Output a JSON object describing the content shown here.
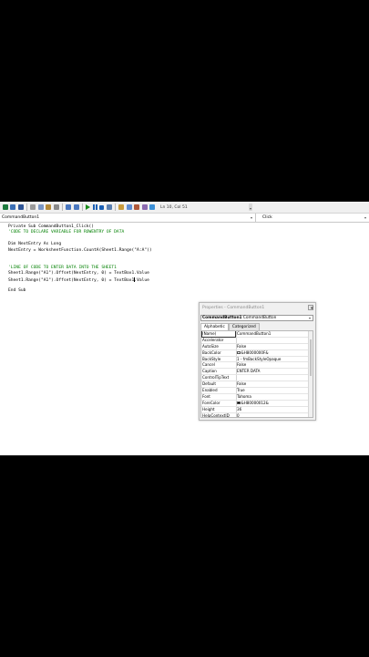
{
  "toolbar": {
    "icons": [
      "excel-icon",
      "insert-userform-icon",
      "save-icon",
      "cut-icon",
      "copy-icon",
      "paste-icon",
      "find-icon",
      "undo-icon",
      "redo-icon",
      "run-icon",
      "break-icon",
      "reset-icon",
      "design-mode-icon",
      "project-explorer-icon",
      "properties-icon",
      "object-browser-icon",
      "toolbox-icon",
      "help-icon"
    ],
    "status": "Ln 10, Col 51"
  },
  "object_combo": "CommandButton1",
  "procedure_combo": "Click",
  "code": {
    "lines": [
      {
        "text": "Private Sub CommandButton1_Click()",
        "type": "code"
      },
      {
        "text": "'CODE TO DECLARE VARIABLE FOR ROWENTRY OF DATA",
        "type": "comment"
      },
      {
        "text": "",
        "type": "code"
      },
      {
        "text": "Dim NextEntry As Long",
        "type": "code"
      },
      {
        "text": "NextEntry = WorksheetFunction.CountA(Sheet1.Range(\"A:A\"))",
        "type": "code"
      },
      {
        "text": "",
        "type": "code"
      },
      {
        "text": "",
        "type": "code"
      },
      {
        "text": "'LINE OF CODE TO ENTER DATA INTO THE SHEET1",
        "type": "comment"
      },
      {
        "text": "Sheet1.Range(\"A1\").Offset(NextEntry, 0) = TextBox1.Value",
        "type": "code"
      },
      {
        "text": "Sheet1.Range(\"A1\").Offset(NextEntry, 0) = TextBox1.Value",
        "type": "code"
      },
      {
        "text": "",
        "type": "code"
      },
      {
        "text": "End Sub",
        "type": "code"
      }
    ]
  },
  "properties": {
    "title": "Properties - CommandButton1",
    "object_name": "CommandButton1",
    "object_type": "CommandButton",
    "tabs": [
      "Alphabetic",
      "Categorized"
    ],
    "rows": [
      {
        "name": "(Name)",
        "value": "CommandButton1",
        "selected": true
      },
      {
        "name": "Accelerator",
        "value": ""
      },
      {
        "name": "AutoSize",
        "value": "False"
      },
      {
        "name": "BackColor",
        "value": "&H8000000F&",
        "swatch": "#f0f0f0"
      },
      {
        "name": "BackStyle",
        "value": "1 - fmBackStyleOpaque"
      },
      {
        "name": "Cancel",
        "value": "False"
      },
      {
        "name": "Caption",
        "value": "ENTER DATA"
      },
      {
        "name": "ControlTipText",
        "value": ""
      },
      {
        "name": "Default",
        "value": "False"
      },
      {
        "name": "Enabled",
        "value": "True"
      },
      {
        "name": "Font",
        "value": "Tahoma"
      },
      {
        "name": "ForeColor",
        "value": "&H80000012&",
        "swatch": "#000000"
      },
      {
        "name": "Height",
        "value": "36"
      },
      {
        "name": "HelpContextID",
        "value": "0"
      }
    ]
  },
  "colors": {
    "comment": "#008000",
    "code": "#000000",
    "background": "#000000"
  }
}
